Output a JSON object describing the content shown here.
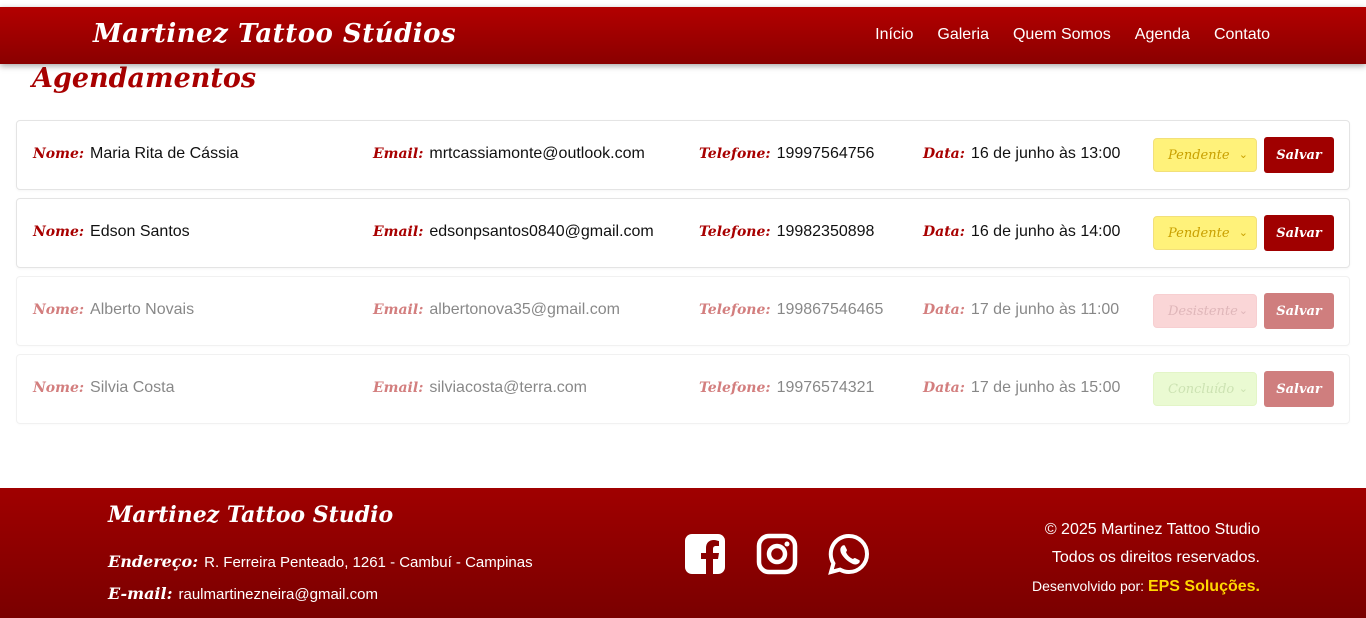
{
  "header": {
    "brand": "Martinez Tattoo Stúdios",
    "nav": [
      "Início",
      "Galeria",
      "Quem Somos",
      "Agenda",
      "Contato"
    ]
  },
  "page": {
    "title": "Agendamentos"
  },
  "labels": {
    "nome": "Nome:",
    "email": "Email:",
    "telefone": "Telefone:",
    "data": "Data:",
    "save": "Salvar"
  },
  "appointments": [
    {
      "nome": "Maria Rita de Cássia",
      "email": "mrtcassiamonte@outlook.com",
      "telefone": "19997564756",
      "data": "16 de junho às 13:00",
      "status": "Pendente"
    },
    {
      "nome": "Edson Santos",
      "email": "edsonpsantos0840@gmail.com",
      "telefone": "19982350898",
      "data": "16 de junho às 14:00",
      "status": "Pendente"
    },
    {
      "nome": "Alberto Novais",
      "email": "albertonova35@gmail.com",
      "telefone": "199867546465",
      "data": "17 de junho às 11:00",
      "status": "Desistente"
    },
    {
      "nome": "Silvia Costa",
      "email": "silviacosta@terra.com",
      "telefone": "19976574321",
      "data": "17 de junho às 15:00",
      "status": "Concluído"
    }
  ],
  "colors": {
    "primary": "#a00000",
    "pendente": "#fff27a",
    "desistente": "#f7aeb0",
    "concluido": "#d6f7a6",
    "highlight": "#ffd700"
  },
  "footer": {
    "brand": "Martinez Tattoo Studio",
    "address_label": "Endereço:",
    "address": "R. Ferreira Penteado, 1261 - Cambuí - Campinas",
    "email_label": "E-mail:",
    "email": "raulmartinezneira@gmail.com",
    "social_icons": [
      "facebook-icon",
      "instagram-icon",
      "whatsapp-icon"
    ],
    "copyright": "© 2025 Martinez Tattoo Studio",
    "rights": "Todos os direitos reservados.",
    "dev_prefix": "Desenvolvido por:",
    "dev_name": "EPS Soluções."
  }
}
